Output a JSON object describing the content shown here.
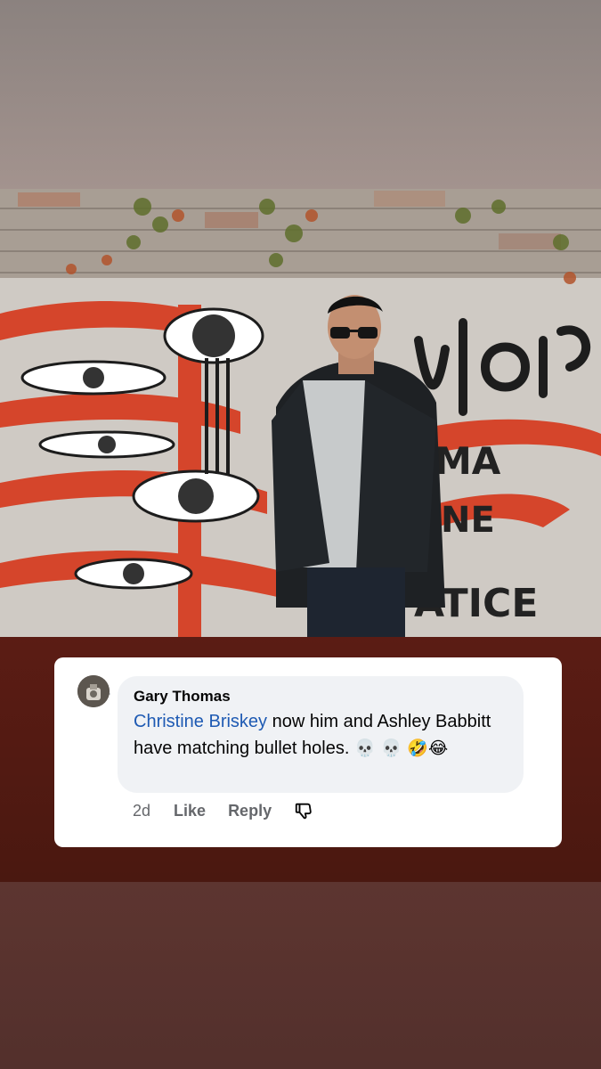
{
  "comment": {
    "author": "Gary Thomas",
    "mention": "Christine Briskey",
    "text": " now him and Ashley Babbitt have matching bullet holes. ",
    "emojis": "💀 💀 🤣😂",
    "time": "2d",
    "like_label": "Like",
    "reply_label": "Reply"
  },
  "photo": {
    "graffiti_letters": [
      "MA",
      "NE",
      "ATICE"
    ]
  },
  "colors": {
    "mention": "#1e5ab3",
    "bubble": "#f0f2f5",
    "meta_text": "#65676b",
    "dark_band": "#5b1c14",
    "graffiti_red": "#d5452b"
  },
  "icons": {
    "avatar": "avatar-image",
    "dislike": "thumbs-down-icon"
  }
}
